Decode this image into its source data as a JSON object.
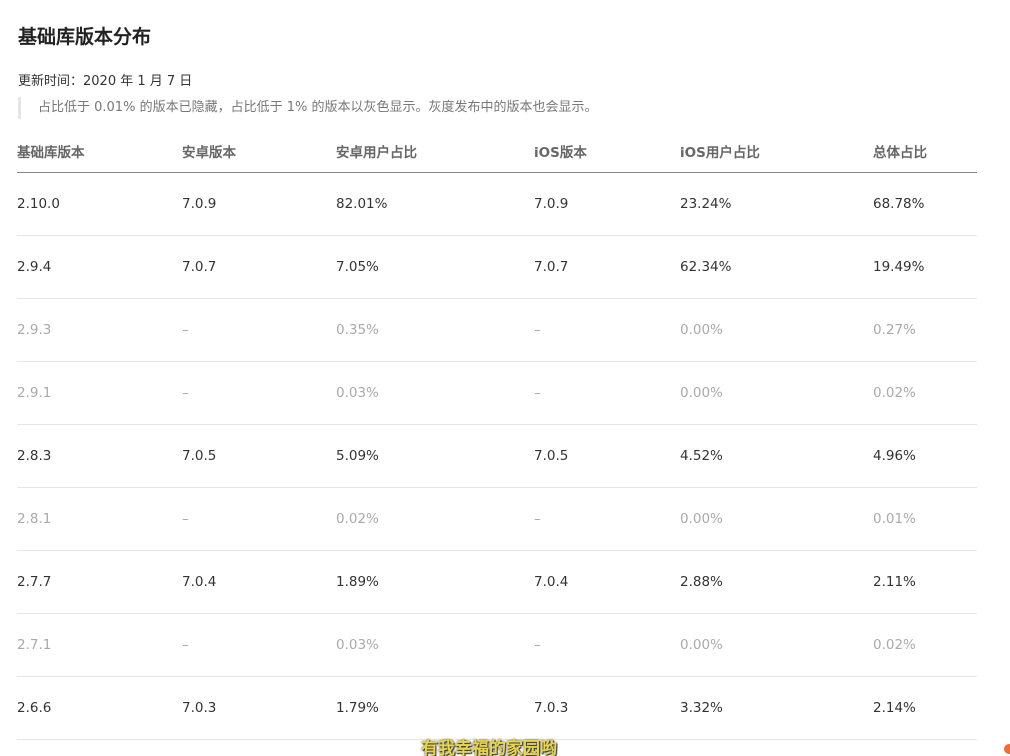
{
  "page": {
    "title": "基础库版本分布",
    "updated": "更新时间：2020 年 1 月 7 日",
    "note": "占比低于 0.01% 的版本已隐藏，占比低于 1% 的版本以灰色显示。灰度发布中的版本也会显示。"
  },
  "table": {
    "headers": [
      "基础库版本",
      "安卓版本",
      "安卓用户占比",
      "iOS版本",
      "iOS用户占比",
      "总体占比"
    ],
    "rows": [
      {
        "lib": "2.10.0",
        "android": "7.0.9",
        "android_pct": "82.01%",
        "ios": "7.0.9",
        "ios_pct": "23.24%",
        "total": "68.78%"
      },
      {
        "lib": "2.9.4",
        "android": "7.0.7",
        "android_pct": "7.05%",
        "ios": "7.0.7",
        "ios_pct": "62.34%",
        "total": "19.49%"
      },
      {
        "lib": "2.9.3",
        "android": "–",
        "android_pct": "0.35%",
        "ios": "–",
        "ios_pct": "0.00%",
        "total": "0.27%"
      },
      {
        "lib": "2.9.1",
        "android": "–",
        "android_pct": "0.03%",
        "ios": "–",
        "ios_pct": "0.00%",
        "total": "0.02%"
      },
      {
        "lib": "2.8.3",
        "android": "7.0.5",
        "android_pct": "5.09%",
        "ios": "7.0.5",
        "ios_pct": "4.52%",
        "total": "4.96%"
      },
      {
        "lib": "2.8.1",
        "android": "–",
        "android_pct": "0.02%",
        "ios": "–",
        "ios_pct": "0.00%",
        "total": "0.01%"
      },
      {
        "lib": "2.7.7",
        "android": "7.0.4",
        "android_pct": "1.89%",
        "ios": "7.0.4",
        "ios_pct": "2.88%",
        "total": "2.11%"
      },
      {
        "lib": "2.7.1",
        "android": "–",
        "android_pct": "0.03%",
        "ios": "–",
        "ios_pct": "0.00%",
        "total": "0.02%"
      },
      {
        "lib": "2.6.6",
        "android": "7.0.3",
        "android_pct": "1.79%",
        "ios": "7.0.3",
        "ios_pct": "3.32%",
        "total": "2.14%"
      }
    ]
  },
  "overlay": {
    "subtitle": "有我幸福的家园哟"
  },
  "colors": {
    "text": "#333333",
    "muted_row": "#aaaaaa",
    "header_text": "#666666",
    "subtitle_text": "#e8d64a",
    "edge_dot": "#f26a36"
  }
}
